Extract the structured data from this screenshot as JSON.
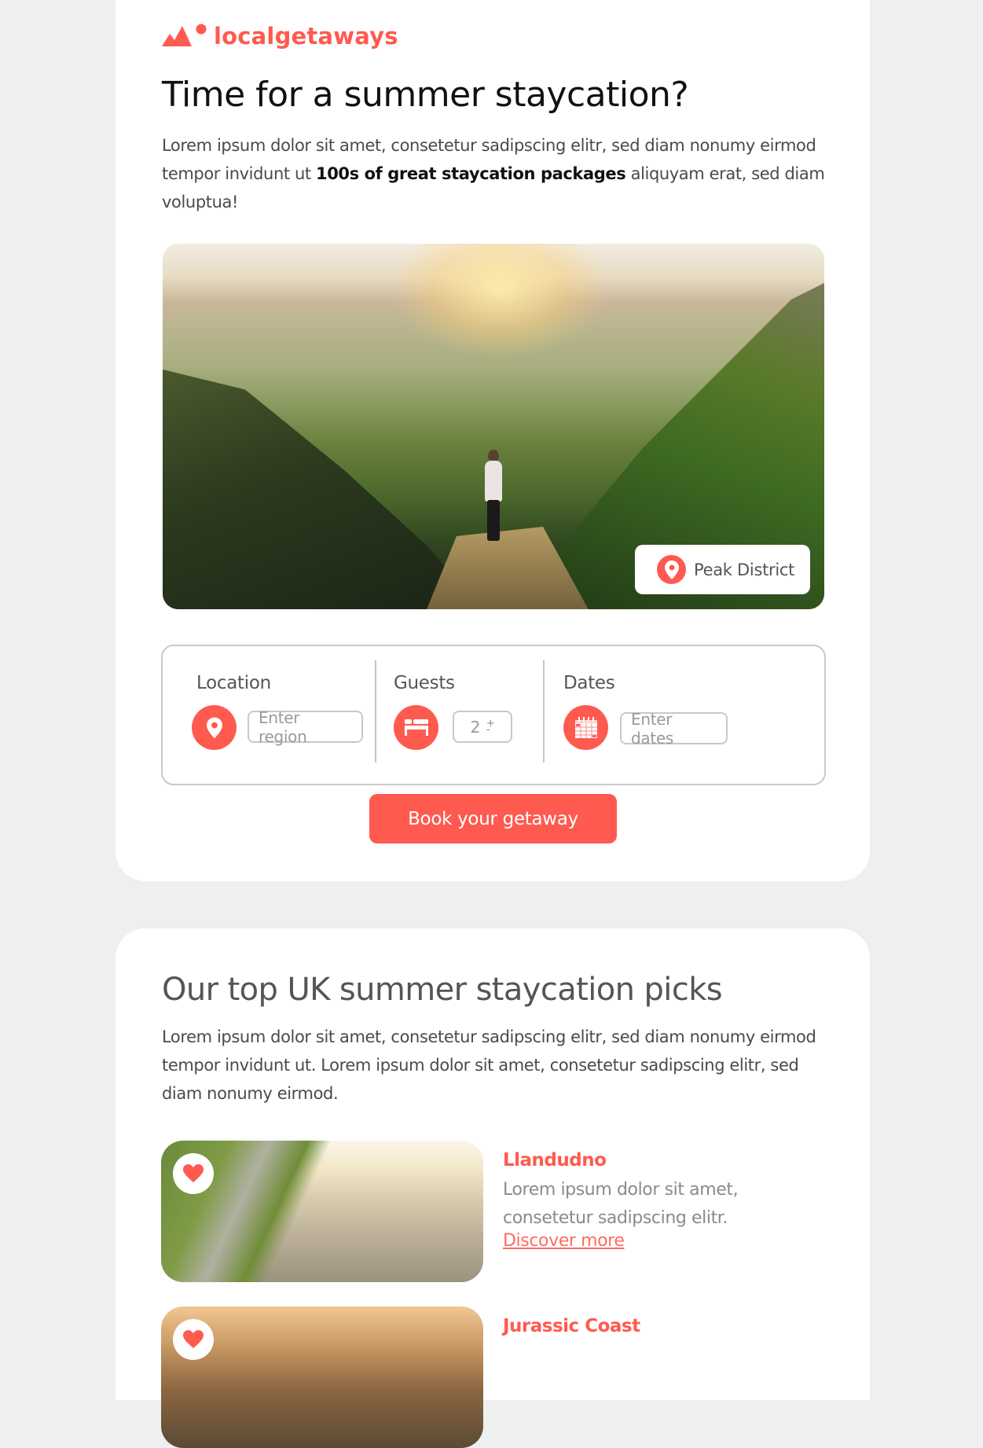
{
  "brand": {
    "name": "localgetaways",
    "accent_color": "#ff5a4f"
  },
  "hero": {
    "title": "Time for a summer staycation?",
    "intro_before": "Lorem ipsum dolor sit amet, consetetur sadipscing elitr, sed diam nonumy eirmod tempor invidunt ut ",
    "intro_bold": "100s of great staycation packages",
    "intro_after": " aliquyam erat, sed diam voluptua!",
    "image_location": "Peak District",
    "image_location_icon": "map-pin-icon"
  },
  "search": {
    "location": {
      "label": "Location",
      "icon": "map-pin-icon",
      "placeholder": "Enter region"
    },
    "guests": {
      "label": "Guests",
      "icon": "bed-icon",
      "value": "2",
      "increment": "+",
      "decrement": "-"
    },
    "dates": {
      "label": "Dates",
      "icon": "calendar-icon",
      "placeholder": "Enter dates"
    },
    "submit_label": "Book your getaway"
  },
  "picks": {
    "title": "Our top UK summer staycation picks",
    "intro": "Lorem ipsum dolor sit amet, consetetur sadipscing elitr, sed diam nonumy eirmod tempor invidunt ut. Lorem ipsum dolor sit amet, consetetur sadipscing elitr, sed diam nonumy eirmod.",
    "items": [
      {
        "name": "Llandudno",
        "description": "Lorem ipsum dolor sit amet, consetetur sadipscing elitr.",
        "link": "Discover more",
        "favorite_icon": "heart-icon"
      },
      {
        "name": "Jurassic Coast",
        "favorite_icon": "heart-icon"
      }
    ]
  }
}
